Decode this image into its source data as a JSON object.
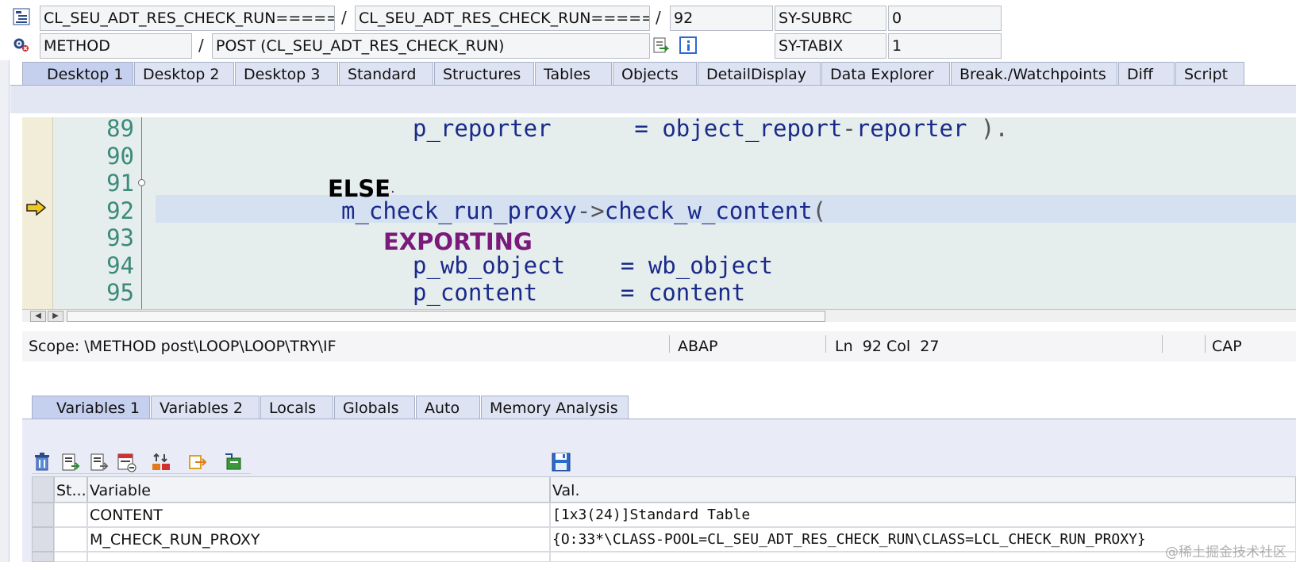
{
  "header": {
    "row1": {
      "program": "CL_SEU_ADT_RES_CHECK_RUN=====…",
      "include": "CL_SEU_ADT_RES_CHECK_RUN=====…",
      "sep1": "/",
      "sep2": "/",
      "line": "92",
      "sysvar_name": "SY-SUBRC",
      "sysvar_value": "0"
    },
    "row2": {
      "event_type": "METHOD",
      "sep": "/",
      "event": "POST (CL_SEU_ADT_RES_CHECK_RUN)",
      "sysvar_name": "SY-TABIX",
      "sysvar_value": "1"
    }
  },
  "main_tabs": [
    "Desktop 1",
    "Desktop 2",
    "Desktop 3",
    "Standard",
    "Structures",
    "Tables",
    "Objects",
    "DetailDisplay",
    "Data Explorer",
    "Break./Watchpoints",
    "Diff",
    "Script"
  ],
  "editor": {
    "line_numbers": [
      "89",
      "90",
      "91",
      "92",
      "93",
      "94",
      "95"
    ],
    "lines": {
      "l89_a": "p_reporter",
      "l89_b": "=",
      "l89_c": "object_report",
      "l89_d": "-",
      "l89_e": "reporter",
      "l89_f": " ).",
      "l91": "ELSE",
      "l92_a": "m_check_run_proxy",
      "l92_b": "->",
      "l92_c": "check_w_content",
      "l92_d": "(",
      "l93": "EXPORTING",
      "l94_a": "p_wb_object",
      "l94_b": "=",
      "l94_c": "wb_object",
      "l95_a": "p_content",
      "l95_b": "=",
      "l95_c": "content"
    }
  },
  "status_bar": {
    "scope": "Scope: \\METHOD post\\LOOP\\LOOP\\TRY\\IF",
    "language": "ABAP",
    "ln_label": "Ln",
    "ln": "92",
    "col_label": "Col",
    "col": "27",
    "caps": "CAP"
  },
  "var_tabs": [
    "Variables 1",
    "Variables 2",
    "Locals",
    "Globals",
    "Auto",
    "Memory Analysis"
  ],
  "var_table": {
    "columns": [
      "St...",
      "Variable",
      "Val."
    ],
    "rows": [
      {
        "variable": "CONTENT",
        "value": "[1x3(24)]Standard Table"
      },
      {
        "variable": "M_CHECK_RUN_PROXY",
        "value": "{O:33*\\CLASS-POOL=CL_SEU_ADT_RES_CHECK_RUN\\CLASS=LCL_CHECK_RUN_PROXY}"
      }
    ]
  },
  "watermark": "@稀土掘金技术社区",
  "colors": {
    "tab_active": "#c5cfee",
    "tab_inactive": "#dee3f3",
    "editor_bg": "#e6eded",
    "current_line": "#d5e1f1",
    "keyword_purple": "#7a1a7a",
    "identifier_blue": "#1a2a8a"
  }
}
